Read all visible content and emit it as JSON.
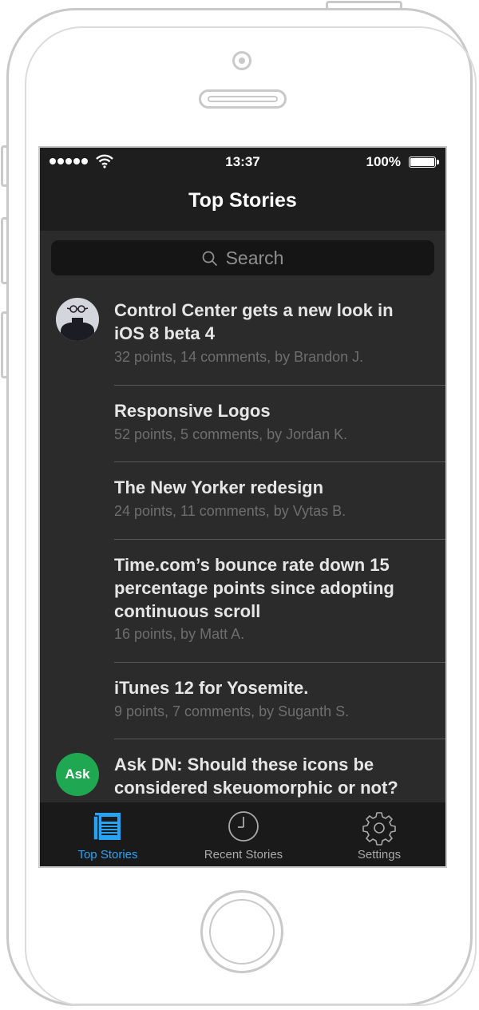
{
  "status_bar": {
    "time": "13:37",
    "battery": "100%"
  },
  "nav": {
    "title": "Top Stories"
  },
  "search": {
    "placeholder": "Search"
  },
  "stories": [
    {
      "title": "Control Center gets a new look in iOS 8 beta 4",
      "meta": "32 points, 14 comments, by Brandon J.",
      "avatar": "user-avatar"
    },
    {
      "title": "Responsive Logos",
      "meta": "52 points, 5 comments, by Jordan K."
    },
    {
      "title": "The New Yorker redesign",
      "meta": "24 points, 11 comments, by Vytas B."
    },
    {
      "title": "Time.com’s bounce rate down 15 percentage points since adopting continuous scroll",
      "meta": "16 points, by Matt A."
    },
    {
      "title": "iTunes 12 for Yosemite.",
      "meta": "9 points, 7 comments, by Suganth S."
    },
    {
      "title": "Ask DN: Should these icons be considered skeuomorphic or not?",
      "badge": "Ask",
      "badge_color": "#1fa851"
    }
  ],
  "tabs": [
    {
      "label": "Top Stories",
      "icon": "newspaper-icon",
      "active": true
    },
    {
      "label": "Recent Stories",
      "icon": "clock-icon",
      "active": false
    },
    {
      "label": "Settings",
      "icon": "gear-icon",
      "active": false
    }
  ],
  "colors": {
    "accent": "#27a3f5",
    "background": "#2b2b2b",
    "bar": "#1e1e1e"
  }
}
